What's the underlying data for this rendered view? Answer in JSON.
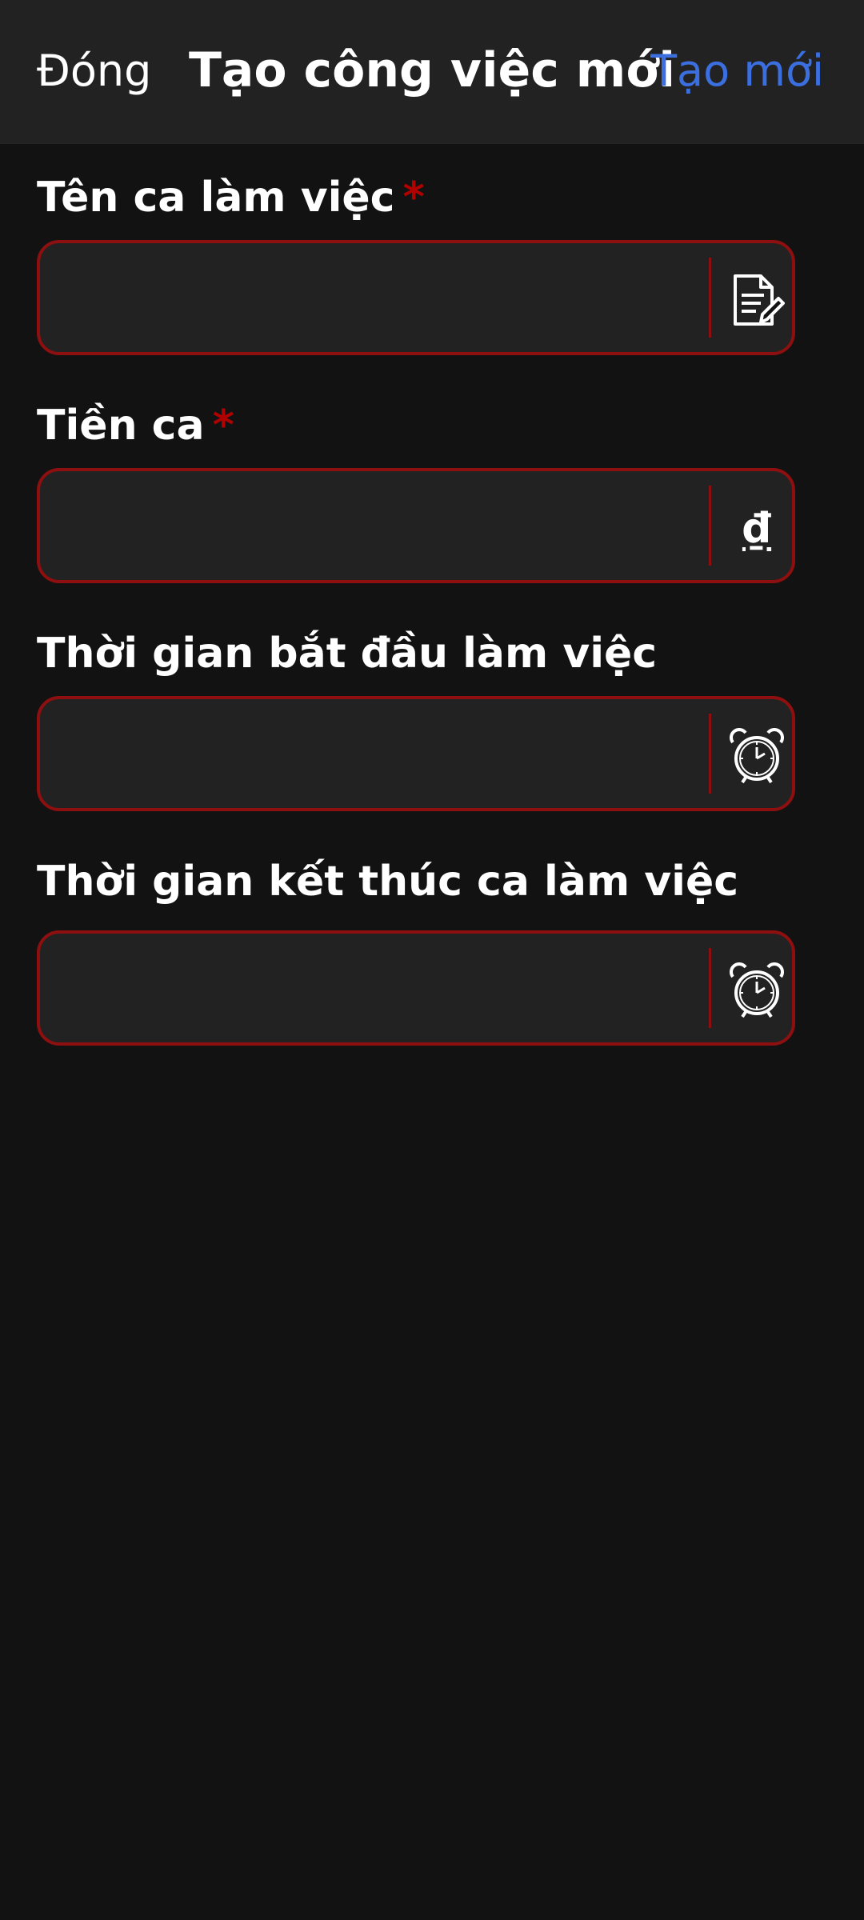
{
  "header": {
    "close_label": "Đóng",
    "title": "Tạo công việc mới",
    "create_label": "Tạo mới",
    "create_color": "#3b6fe0"
  },
  "form": {
    "fields": [
      {
        "label": "Tên ca làm việc",
        "required": "*",
        "value": "",
        "icon": "document-edit-icon"
      },
      {
        "label": "Tiền ca",
        "required": "*",
        "value": "",
        "icon": "vnd-currency-icon",
        "icon_glyph": "₫"
      },
      {
        "label": "Thời gian bắt đầu làm việc",
        "value": "",
        "icon": "alarm-clock-icon"
      },
      {
        "label": "Thời gian kết thúc ca làm việc",
        "value": "",
        "icon": "alarm-clock-icon"
      }
    ],
    "border_color": "#8e0f0f",
    "required_color": "#b00000"
  }
}
